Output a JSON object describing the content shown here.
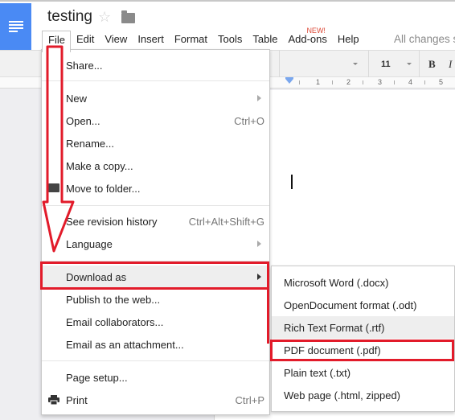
{
  "header": {
    "app_icon": "docs-menu-icon",
    "doc_title": "testing",
    "star_icon": "star-icon",
    "folder_icon": "folder-icon",
    "save_status": "All changes saved in Drive"
  },
  "menubar": {
    "items": [
      {
        "label": "File",
        "active": true
      },
      {
        "label": "Edit"
      },
      {
        "label": "View"
      },
      {
        "label": "Insert"
      },
      {
        "label": "Format"
      },
      {
        "label": "Tools"
      },
      {
        "label": "Table"
      },
      {
        "label": "Add-ons",
        "badge": "NEW!"
      },
      {
        "label": "Help"
      }
    ]
  },
  "toolbar": {
    "font_size": "11",
    "bold_label": "B",
    "italic_label": "I"
  },
  "ruler": {
    "numbers": [
      "1",
      "2",
      "3",
      "4",
      "5"
    ]
  },
  "file_menu": {
    "items": [
      {
        "label": "Share..."
      },
      {
        "label": "New",
        "submenu": true
      },
      {
        "label": "Open...",
        "shortcut": "Ctrl+O"
      },
      {
        "label": "Rename..."
      },
      {
        "label": "Make a copy..."
      },
      {
        "label": "Move to folder...",
        "icon": "folder-icon"
      },
      {
        "label": "See revision history",
        "shortcut": "Ctrl+Alt+Shift+G"
      },
      {
        "label": "Language",
        "submenu": true
      },
      {
        "label": "Download as",
        "submenu": true,
        "highlighted": true
      },
      {
        "label": "Publish to the web..."
      },
      {
        "label": "Email collaborators..."
      },
      {
        "label": "Email as an attachment..."
      },
      {
        "label": "Page setup..."
      },
      {
        "label": "Print",
        "shortcut": "Ctrl+P",
        "icon": "printer-icon"
      }
    ]
  },
  "download_submenu": {
    "items": [
      {
        "label": "Microsoft Word (.docx)"
      },
      {
        "label": "OpenDocument format (.odt)"
      },
      {
        "label": "Rich Text Format (.rtf)",
        "hover": true
      },
      {
        "label": "PDF document (.pdf)",
        "annotated": true
      },
      {
        "label": "Plain text (.txt)"
      },
      {
        "label": "Web page (.html, zipped)"
      }
    ]
  },
  "annotation": {
    "color": "#e21b2a"
  }
}
